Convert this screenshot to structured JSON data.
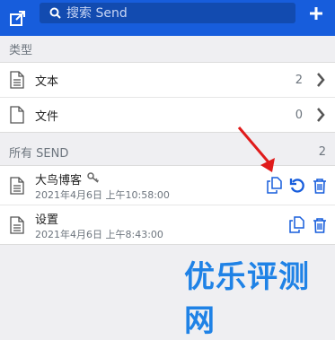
{
  "search": {
    "placeholder": "搜索 Send"
  },
  "icons": {
    "back": "return-arrow-icon",
    "search": "search-icon",
    "add": "plus-icon",
    "text": "document-text-icon",
    "file": "file-icon",
    "chevron": "chevron-right-icon",
    "key": "key-icon",
    "copy": "copy-link-icon",
    "remove_password": "undo-icon",
    "delete": "trash-icon"
  },
  "types": {
    "header": "类型",
    "items": [
      {
        "label": "文本",
        "count": "2"
      },
      {
        "label": "文件",
        "count": "0"
      }
    ]
  },
  "sends": {
    "header": "所有 SEND",
    "count": "2",
    "items": [
      {
        "title": "大鸟博客",
        "date": "2021年4月6日 上午10:58:00",
        "has_password": true
      },
      {
        "title": "设置",
        "date": "2021年4月6日 上午8:43:00",
        "has_password": false
      }
    ]
  },
  "watermark": "优乐评测网",
  "colors": {
    "brand": "#175ddc",
    "accent_icon": "#175ddc",
    "annotation_arrow": "#e01b1b",
    "watermark": "#1f82e6"
  }
}
